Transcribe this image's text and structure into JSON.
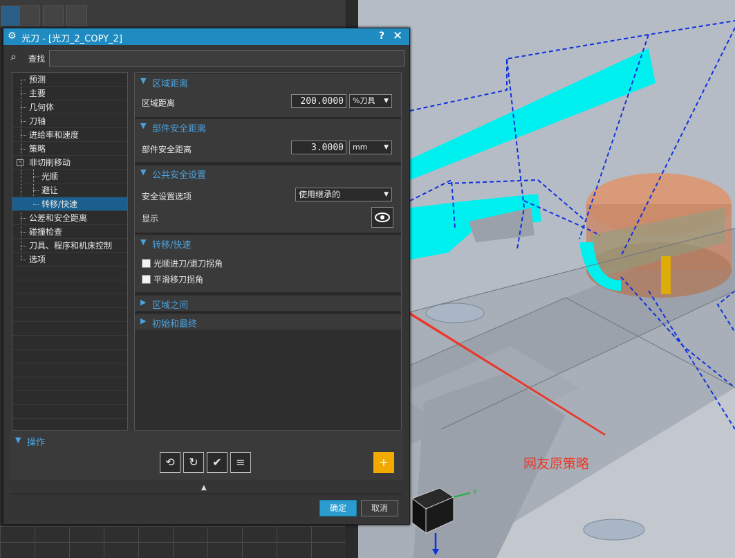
{
  "dialog": {
    "title": "光刀 - [光刀_2_COPY_2]",
    "help_label": "?",
    "close_label": "✕",
    "search_label": "查找",
    "search_value": ""
  },
  "tree": {
    "items": [
      "预测",
      "主要",
      "几何体",
      "刀轴",
      "进给率和速度",
      "策略",
      "非切削移动",
      "光顺",
      "避让",
      "转移/快速",
      "公差和安全距离",
      "碰撞检查",
      "刀具、程序和机床控制",
      "选项"
    ],
    "selected": "转移/快速"
  },
  "sections": {
    "zone_distance": {
      "title": "区域距离",
      "field_label": "区域距离",
      "value": "200.0000",
      "unit": "%刀具"
    },
    "part_safety": {
      "title": "部件安全距离",
      "field_label": "部件安全距离",
      "value": "3.0000",
      "unit": "mm"
    },
    "common_safety": {
      "title": "公共安全设置",
      "option_label": "安全设置选项",
      "option_value": "使用继承的",
      "display_label": "显示"
    },
    "transfer": {
      "title": "转移/快速",
      "checkbox1": "光顺进刀/退刀拐角",
      "checkbox2": "平滑移刀拐角"
    },
    "between_regions": {
      "title": "区域之间"
    },
    "start_end": {
      "title": "初始和最终"
    }
  },
  "operations": {
    "title": "操作"
  },
  "buttons": {
    "ok": "确定",
    "cancel": "取消"
  },
  "annotation": {
    "text": "网友原策略",
    "color": "#e8392b"
  },
  "colors": {
    "accent": "#1f8bc0",
    "header_text": "#4aa3df",
    "selected_row": "#1a5f8d",
    "toolpath_cyan": "#00f0f0"
  }
}
